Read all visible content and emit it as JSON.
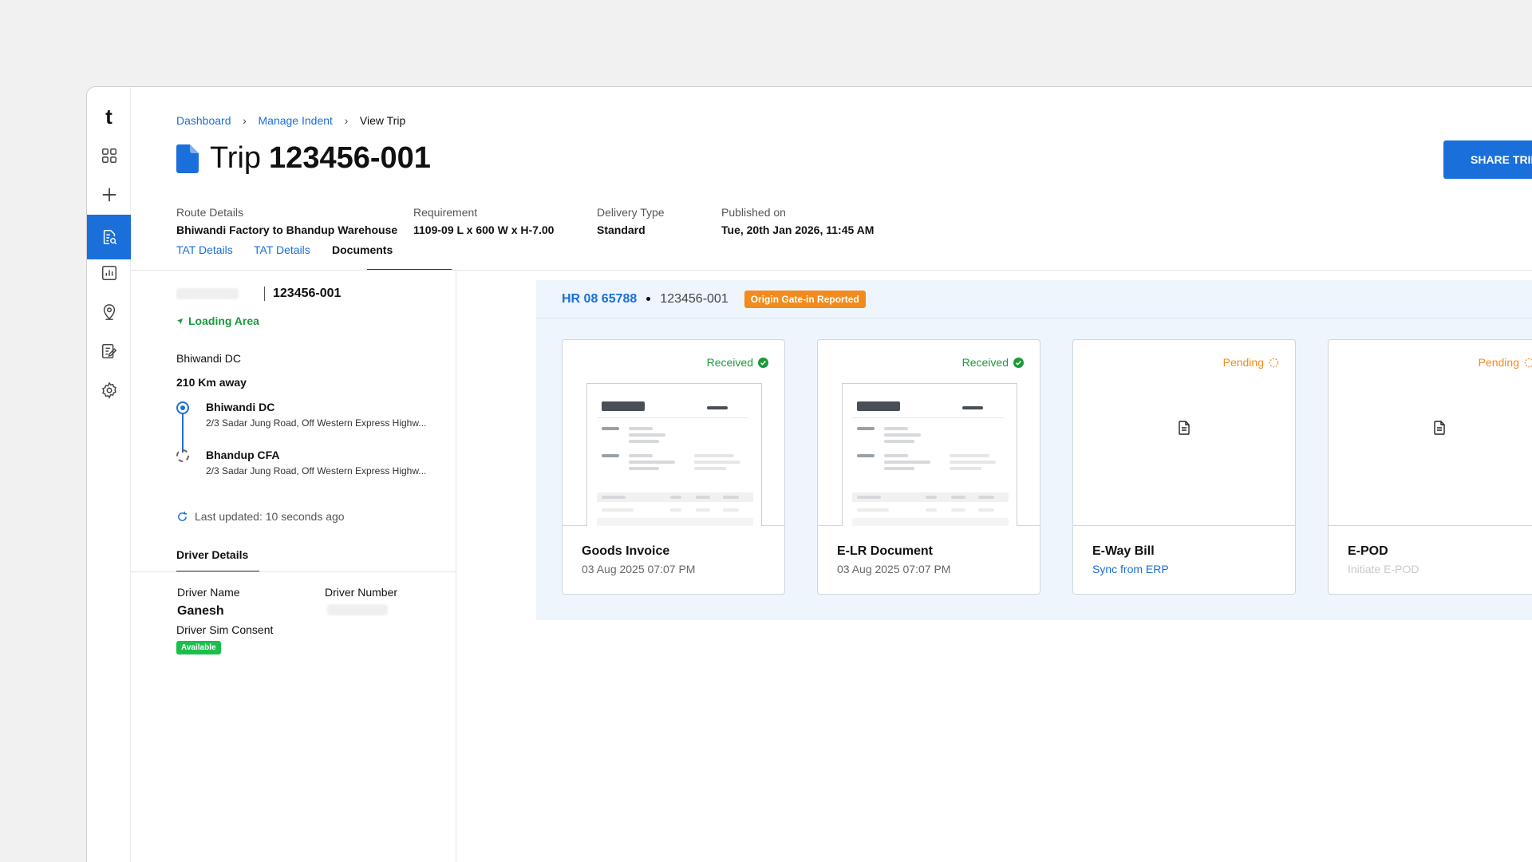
{
  "app": {
    "logo": "t"
  },
  "sidebar": {
    "items": [
      {
        "icon": "grid-icon"
      },
      {
        "icon": "plus-icon"
      },
      {
        "icon": "document-search-icon",
        "active": true
      },
      {
        "icon": "chart-icon"
      },
      {
        "icon": "location-pin-icon"
      },
      {
        "icon": "edit-note-icon"
      },
      {
        "icon": "gear-icon"
      }
    ]
  },
  "breadcrumb": [
    "Dashboard",
    "Manage Indent",
    "View Trip"
  ],
  "header": {
    "title_prefix": "Trip",
    "title_id": "123456-001",
    "share_button": "SHARE TRIP"
  },
  "meta": {
    "route": {
      "label": "Route Details",
      "value": "Bhiwandi Factory to Bhandup Warehouse"
    },
    "requirement": {
      "label": "Requirement",
      "value": "1109-09 L x 600 W x H-7.00"
    },
    "delivery": {
      "label": "Delivery Type",
      "value": "Standard"
    },
    "published": {
      "label": "Published on",
      "value": "Tue, 20th Jan 2026, 11:45 AM"
    }
  },
  "tabs": [
    "TAT Details",
    "TAT Details",
    "Documents"
  ],
  "trip_panel": {
    "trip_id": "123456-001",
    "loading_area": "Loading Area",
    "location": "Bhiwandi DC",
    "distance": "210 Km away",
    "stops": [
      {
        "name": "Bhiwandi DC",
        "address": "2/3 Sadar Jung Road, Off Western Express Highw..."
      },
      {
        "name": "Bhandup CFA",
        "address": "2/3 Sadar Jung Road, Off Western Express Highw..."
      }
    ],
    "last_updated": "Last updated: 10 seconds ago"
  },
  "driver": {
    "tab": "Driver Details",
    "name_label": "Driver Name",
    "name_value": "Ganesh",
    "number_label": "Driver Number",
    "sim_label": "Driver Sim Consent",
    "sim_status": "Available"
  },
  "documents": {
    "vehicle_no": "HR 08 65788",
    "trip_id": "123456-001",
    "status_badge": "Origin Gate-in Reported",
    "cards": [
      {
        "title": "Goods Invoice",
        "state": "Received",
        "sub": "03 Aug 2025 07:07 PM"
      },
      {
        "title": "E-LR Document",
        "state": "Received",
        "sub": "03 Aug 2025 07:07 PM"
      },
      {
        "title": "E-Way Bill",
        "state": "Pending",
        "sub": "Sync from ERP"
      },
      {
        "title": "E-POD",
        "state": "Pending",
        "sub": "Initiate E-POD"
      }
    ]
  },
  "colors": {
    "accent": "#1a6fdb",
    "success": "#1a9a3a",
    "warning": "#f28b1d"
  }
}
